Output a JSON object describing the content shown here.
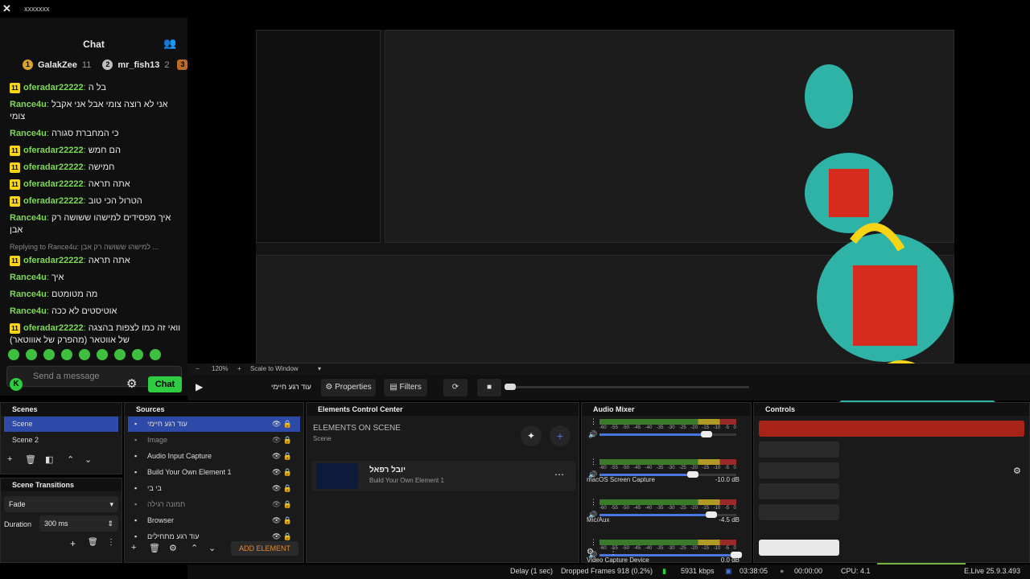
{
  "window_title": "xxxxxxx",
  "chat": {
    "title": "Chat",
    "leaders": [
      {
        "name": "GalakZee",
        "count": "11"
      },
      {
        "name": "mr_fish13",
        "count": "2"
      }
    ],
    "messages": [
      {
        "user": "oferadar22222",
        "text": "בל ה",
        "badge": "11"
      },
      {
        "user": "Rance4u",
        "text": "אני לא רוצה צומי אבל אני אקבל צומי"
      },
      {
        "user": "Rance4u",
        "text": "כי המחברת סגורה"
      },
      {
        "user": "oferadar22222",
        "text": "הם חמש",
        "badge": "11"
      },
      {
        "user": "oferadar22222",
        "text": "חמישה",
        "badge": "11"
      },
      {
        "user": "oferadar22222",
        "text": "אתה תראה",
        "badge": "11"
      },
      {
        "user": "oferadar22222",
        "text": "הטרול הכי טוב",
        "badge": "11"
      },
      {
        "user": "Rance4u",
        "text": "איך מפסידים למישהו ששושה רק אבן"
      },
      {
        "user": "oferadar22222",
        "text": "אתה תראה",
        "badge": "11",
        "reply": "Replying to Rance4u: למישהו ששושה רק אבן ..."
      },
      {
        "user": "Rance4u",
        "text": "איך"
      },
      {
        "user": "Rance4u",
        "text": "מה מטומטם"
      },
      {
        "user": "Rance4u",
        "text": "אוטיסטים לא ככה"
      },
      {
        "user": "oferadar22222",
        "text": "וואי זה כמו לצפות בהצגה של אווטאר (מהפרק של אוווטאר)",
        "badge": "11"
      }
    ],
    "send_placeholder": "Send a message",
    "chat_button": "Chat"
  },
  "preview": {
    "zoom": "120%",
    "scale_mode": "Scale to Window"
  },
  "toolbar": {
    "current_source": "עוד רגע חיימי",
    "properties": "Properties",
    "filters": "Filters"
  },
  "scenes": {
    "title": "Scenes",
    "items": [
      "Scene",
      "Scene 2"
    ]
  },
  "transitions": {
    "title": "Scene Transitions",
    "type": "Fade",
    "duration_label": "Duration",
    "duration": "300 ms"
  },
  "sources": {
    "title": "Sources",
    "items": [
      {
        "label": "עוד רגע חיימי",
        "selected": true
      },
      {
        "label": "Image",
        "dim": true
      },
      {
        "label": "Audio Input Capture"
      },
      {
        "label": "Build Your Own Element 1"
      },
      {
        "label": "בי בי"
      },
      {
        "label": "תמונה רגילה",
        "dim": true
      },
      {
        "label": "Browser"
      },
      {
        "label": "עוד רגע מתחילים"
      }
    ],
    "add_element": "ADD ELEMENT"
  },
  "elements": {
    "title": "Elements Control Center",
    "heading": "ELEMENTS ON SCENE",
    "scene": "Scene",
    "card_title": "יובל רפאל",
    "card_sub": "Build Your Own Element 1"
  },
  "mixer": {
    "title": "Audio Mixer",
    "scale": [
      "-60",
      "-55",
      "-50",
      "-45",
      "-40",
      "-35",
      "-30",
      "-25",
      "-20",
      "-15",
      "-10",
      "-5",
      "0"
    ],
    "channels": [
      {
        "name": "",
        "db": "",
        "volume": 0.78
      },
      {
        "name": "macOS Screen Capture",
        "db": "-10.0 dB",
        "volume": 0.68
      },
      {
        "name": "Mic/Aux",
        "db": "-4.5 dB",
        "volume": 0.82
      },
      {
        "name": "Video Capture Device",
        "db": "0.0 dB",
        "volume": 1.0
      }
    ]
  },
  "controls": {
    "title": "Controls"
  },
  "status": {
    "delay": "Delay (1 sec)",
    "dropped": "Dropped Frames 918 (0.2%)",
    "bitrate": "5931 kbps",
    "time1": "03:38:05",
    "time2": "00:00:00",
    "cpu": "CPU: 4.1",
    "version": "E.Live 25.9.3.493"
  }
}
